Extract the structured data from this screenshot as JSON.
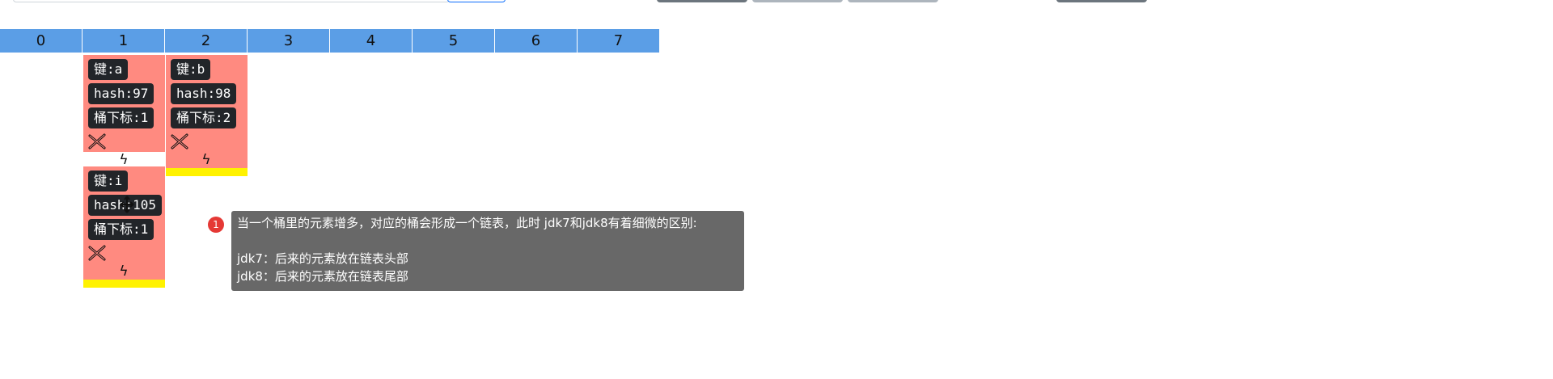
{
  "buckets": [
    "0",
    "1",
    "2",
    "3",
    "4",
    "5",
    "6",
    "7"
  ],
  "nodes": [
    {
      "key": "键:a",
      "hash": "hash:97",
      "index": "桶下标:1"
    },
    {
      "key": "键:b",
      "hash": "hash:98",
      "index": "桶下标:2"
    },
    {
      "key": "键:i",
      "hash": "hash:105",
      "index": "桶下标:1"
    }
  ],
  "icons": {
    "delete": "delete-cross-icon",
    "next": "lightning-arrow-icon",
    "cursor": "move-cursor-icon"
  },
  "tooltip": {
    "badge": "1",
    "line1": "当一个桶里的元素增多，对应的桶会形成一个链表，此时 jdk7和jdk8有着细微的区别:",
    "line2": "jdk7：后来的元素放在链表头部",
    "line3": "jdk8：后来的元素放在链表尾部"
  },
  "colors": {
    "bucket": "#5b9ee6",
    "node": "#ff8a80",
    "tail": "#fff200",
    "tag": "#222529",
    "tooltip": "#686868",
    "badge": "#e53935"
  }
}
